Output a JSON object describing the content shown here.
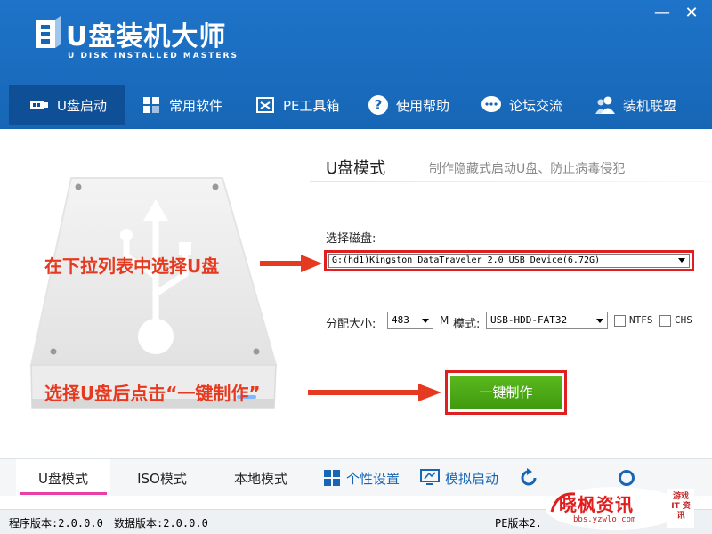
{
  "app": {
    "logo_title": "U盘装机大师",
    "logo_subtitle": "U DISK INSTALLED MASTERS",
    "minimize": "—",
    "close": "✕"
  },
  "nav": {
    "items": [
      {
        "label": "U盘启动",
        "icon": "usb-icon"
      },
      {
        "label": "常用软件",
        "icon": "puzzle-icon"
      },
      {
        "label": "PE工具箱",
        "icon": "toolbox-icon"
      },
      {
        "label": "使用帮助",
        "icon": "question-icon"
      },
      {
        "label": "论坛交流",
        "icon": "chat-icon"
      },
      {
        "label": "装机联盟",
        "icon": "users-icon"
      }
    ]
  },
  "main": {
    "mode_title": "U盘模式",
    "mode_desc": "制作隐藏式启动U盘、防止病毒侵犯",
    "disk_label": "选择磁盘:",
    "disk_value": "G:(hd1)Kingston DataTraveler 2.0 USB Device(6.72G)",
    "alloc_label": "分配大小:",
    "alloc_value": "483",
    "alloc_unit": "M",
    "mode_label": "模式:",
    "mode_value": "USB-HDD-FAT32",
    "ntfs_label": "NTFS",
    "chs_label": "CHS",
    "make_button": "一键制作"
  },
  "annotations": {
    "select_disk": "在下拉列表中选择U盘",
    "click_make": "选择U盘后点击“一键制作”"
  },
  "tabs": {
    "items": [
      {
        "label": "U盘模式"
      },
      {
        "label": "ISO模式"
      },
      {
        "label": "本地模式"
      },
      {
        "label": "个性设置"
      },
      {
        "label": "模拟启动"
      }
    ]
  },
  "status": {
    "program_version": "程序版本:2.0.0.0",
    "data_version": "数据版本:2.0.0.0",
    "pe_version": "PE版本2."
  },
  "watermark": {
    "title": "晓枫资讯",
    "url": "bbs.yzwlo.com",
    "side_text": "游戏 IT 资讯"
  },
  "colors": {
    "header_blue": "#1766b6",
    "nav_active": "#0e4f95",
    "annotation_red": "#e53a1f",
    "button_green": "#4aa716",
    "tab_active_pink": "#e840a8"
  }
}
